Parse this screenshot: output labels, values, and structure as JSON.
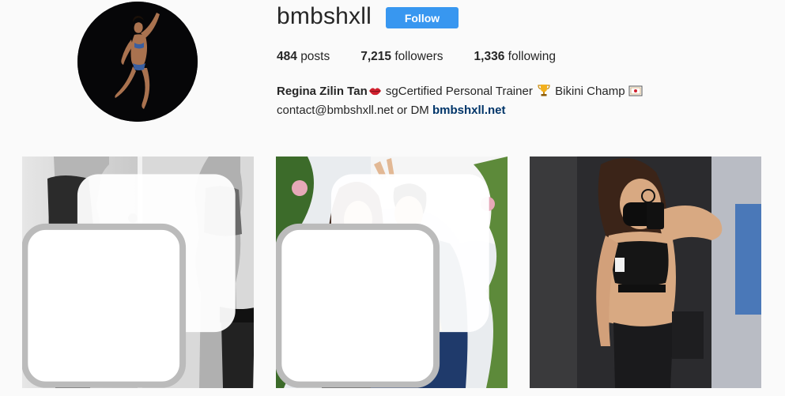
{
  "profile": {
    "username": "bmbshxll",
    "follow_label": "Follow",
    "stats": {
      "posts_count": "484",
      "posts_label": "posts",
      "followers_count": "7,215",
      "followers_label": "followers",
      "following_count": "1,336",
      "following_label": "following"
    },
    "bio": {
      "name": "Regina Zilin Tan",
      "line1_text": " sgCertified Personal Trainer ",
      "line1_text2": " Bikini Champ",
      "line2_text": "contact@bmbshxll.net or DM ",
      "link": "bmbshxll.net"
    }
  },
  "icons": {
    "lips": "kiss-lips-icon",
    "trophy": "trophy-icon",
    "scroll": "certificate-icon",
    "multi": "multiple-posts-icon"
  },
  "colors": {
    "follow_button": "#3897f0",
    "link": "#003569",
    "background": "#fafafa"
  },
  "posts": [
    {
      "kind": "gallery"
    },
    {
      "kind": "gallery"
    },
    {
      "kind": "single"
    }
  ]
}
